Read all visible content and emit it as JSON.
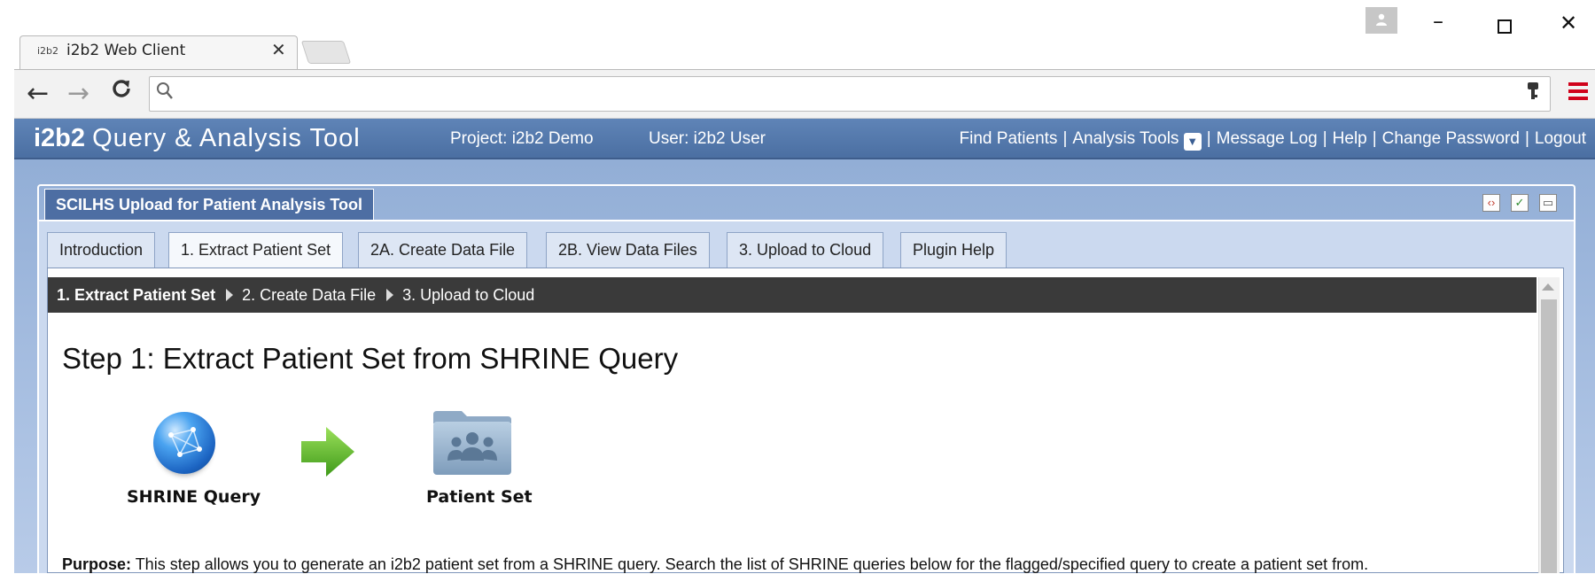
{
  "browser": {
    "tab": {
      "favicon_text": "i2b2",
      "title": "i2b2 Web Client",
      "close": "✕"
    },
    "address": {
      "value": "",
      "placeholder": ""
    },
    "controls": {
      "back": "←",
      "forward": "→",
      "reload": "C",
      "search_icon": "🔍",
      "key_icon": "🔑",
      "profile_icon": "👤",
      "minimize": "–",
      "close": "✕"
    }
  },
  "header": {
    "logo_bold": "i2b2",
    "logo_text": "Query & Analysis Tool",
    "project": "Project: i2b2 Demo",
    "user": "User: i2b2 User",
    "links": {
      "find_patients": "Find Patients",
      "analysis_tools": "Analysis Tools",
      "message_log": "Message Log",
      "help": "Help",
      "change_password": "Change Password",
      "logout": "Logout"
    },
    "separator": "|"
  },
  "panel": {
    "title": "SCILHS Upload for Patient Analysis Tool",
    "tabs": [
      {
        "label": "Introduction"
      },
      {
        "label": "1. Extract Patient Set"
      },
      {
        "label": "2A. Create Data File"
      },
      {
        "label": "2B. View Data Files"
      },
      {
        "label": "3. Upload to Cloud"
      },
      {
        "label": "Plugin Help"
      }
    ],
    "active_tab": "1. Extract Patient Set"
  },
  "steps": {
    "step1": "1. Extract Patient Set",
    "step2": "2. Create Data File",
    "step3": "3. Upload to Cloud"
  },
  "content": {
    "heading": "Step 1: Extract Patient Set from SHRINE Query",
    "icon_shrine_label": "SHRINE Query",
    "icon_patient_label": "Patient Set",
    "purpose_label": "Purpose:",
    "purpose_text": " This step allows you to generate an i2b2 patient set from a SHRINE query. Search the list of SHRINE queries below for the flagged/specified query to create a patient set from."
  },
  "colors": {
    "header_bg": "#4f73a6",
    "workarea_bg": "#a9c0e2",
    "steps_bar_bg": "#3a3a3a",
    "arrow_green": "#5cb82a"
  }
}
